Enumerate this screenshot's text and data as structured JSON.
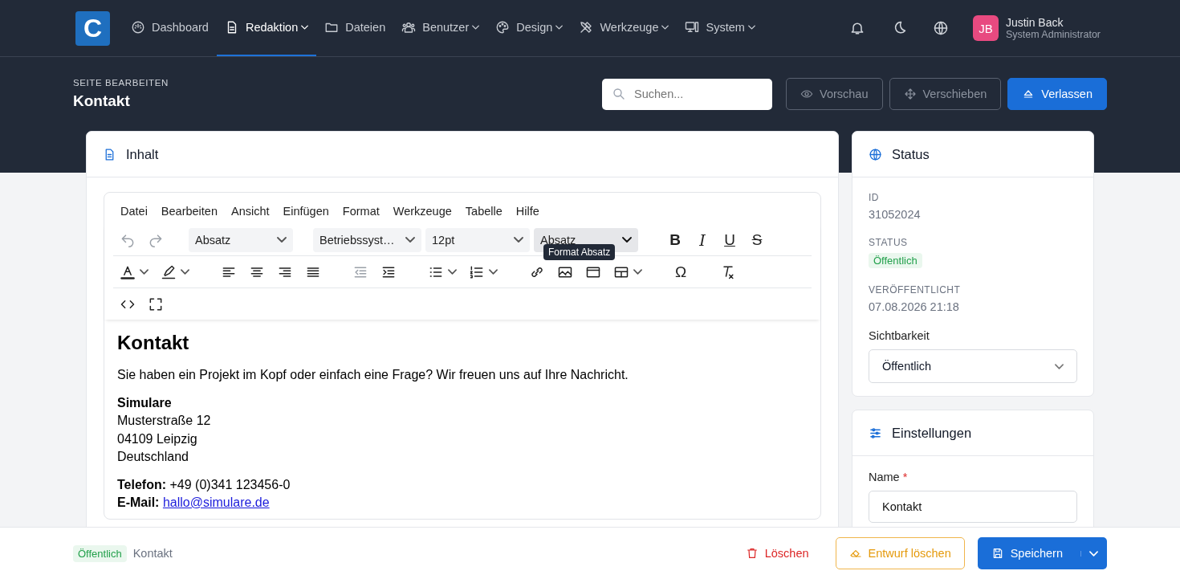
{
  "nav": {
    "logo_letter": "C",
    "items": [
      {
        "label": "Dashboard",
        "selected": false,
        "dropdown": false
      },
      {
        "label": "Redaktion",
        "selected": true,
        "dropdown": true
      },
      {
        "label": "Dateien",
        "selected": false,
        "dropdown": false
      },
      {
        "label": "Benutzer",
        "selected": false,
        "dropdown": true
      },
      {
        "label": "Design",
        "selected": false,
        "dropdown": true
      },
      {
        "label": "Werkzeuge",
        "selected": false,
        "dropdown": true
      },
      {
        "label": "System",
        "selected": false,
        "dropdown": true
      }
    ],
    "user": {
      "initials": "JB",
      "name": "Justin Back",
      "role": "System Administrator"
    }
  },
  "page_header": {
    "eyebrow": "SEITE BEARBEITEN",
    "title": "Kontakt",
    "search": {
      "placeholder": "Suchen..."
    },
    "buttons": [
      {
        "label": "Vorschau",
        "kind": "outline"
      },
      {
        "label": "Verschieben",
        "kind": "outline"
      },
      {
        "label": "Verlassen",
        "kind": "primary"
      }
    ]
  },
  "content_card": {
    "title": "Inhalt",
    "editor": {
      "menu": [
        "Datei",
        "Bearbeiten",
        "Ansicht",
        "Einfügen",
        "Format",
        "Werkzeuge",
        "Tabelle",
        "Hilfe"
      ],
      "selects": [
        {
          "value": "Absatz",
          "selected": false
        },
        {
          "value": "Betriebssyst…",
          "selected": false
        },
        {
          "value": "12pt",
          "selected": false
        },
        {
          "value": "Absatz",
          "selected": true
        }
      ],
      "formats": [
        {
          "glyph": "B",
          "kind": "bold"
        },
        {
          "glyph": "I",
          "kind": "italic"
        },
        {
          "glyph": "U",
          "kind": "underline"
        },
        {
          "glyph": "S",
          "kind": "strike"
        }
      ],
      "special_char": "Ω",
      "tooltip": "Format Absatz",
      "body": {
        "heading": "Kontakt",
        "paragraph": "Sie haben ein Projekt im Kopf oder einfach eine Frage? Wir freuen uns auf Ihre Nachricht.",
        "address": [
          "**Simulare**",
          "Musterstraße 12",
          "04109 Leipzig",
          "Deutschland"
        ],
        "contacts": [
          {
            "label": "Telefon:",
            "value": "+49 (0)341 123456-0",
            "kind": "text"
          },
          {
            "label": "E-Mail:",
            "value": "hallo@simulare.de",
            "kind": "link"
          }
        ]
      }
    }
  },
  "status_card": {
    "title": "Status",
    "fields": [
      {
        "label": "ID",
        "value": "31052024",
        "kind": "text"
      },
      {
        "label": "STATUS",
        "value": "Öffentlich",
        "kind": "badge"
      },
      {
        "label": "VERÖFFENTLICHT",
        "value": "07.08.2026 21:18",
        "kind": "text"
      }
    ],
    "visibility": {
      "label": "Sichtbarkeit",
      "value": "Öffentlich"
    }
  },
  "settings_card": {
    "title": "Einstellungen",
    "name_label": "Name",
    "required_mark": "*",
    "name_value": "Kontakt"
  },
  "footer": {
    "badge": "Öffentlich",
    "title": "Kontakt",
    "buttons": [
      {
        "label": "Löschen",
        "kind": "danger"
      },
      {
        "label": "Entwurf löschen",
        "kind": "warning"
      },
      {
        "label": "Speichern",
        "kind": "primary"
      }
    ]
  }
}
